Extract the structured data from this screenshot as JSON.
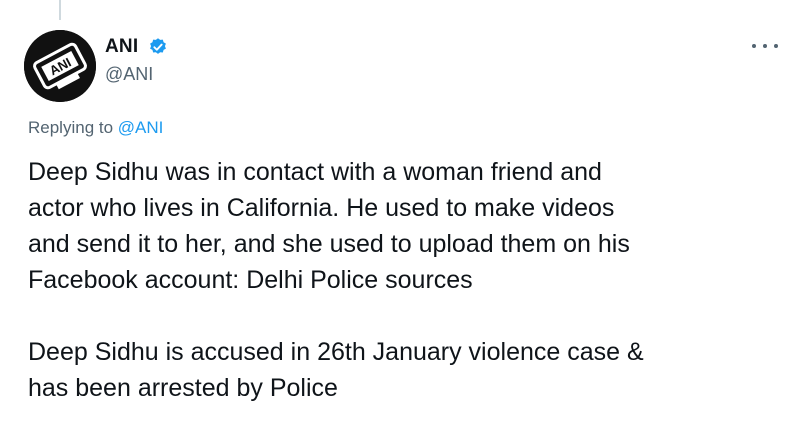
{
  "tweet": {
    "author_name": "ANI",
    "handle": "@ANI",
    "verified": true,
    "avatar_text": "ANI",
    "replying_prefix": "Replying to ",
    "replying_to": "@ANI",
    "paragraph1": [
      "Deep Sidhu was in contact with a woman friend and",
      "actor who lives in California. He used to make videos",
      "and send it to her, and she used to upload them on his",
      "Facebook account: Delhi Police sources"
    ],
    "paragraph2": [
      "Deep Sidhu is accused in 26th January violence case &",
      "has been arrested by Police"
    ]
  },
  "icons": {
    "verified": "verified-badge-icon",
    "more": "more-options-icon"
  },
  "colors": {
    "text": "#0f1419",
    "secondary": "#536471",
    "link": "#1d9bf0",
    "verified": "#1d9bf0",
    "thread_line": "#cfd9de"
  }
}
